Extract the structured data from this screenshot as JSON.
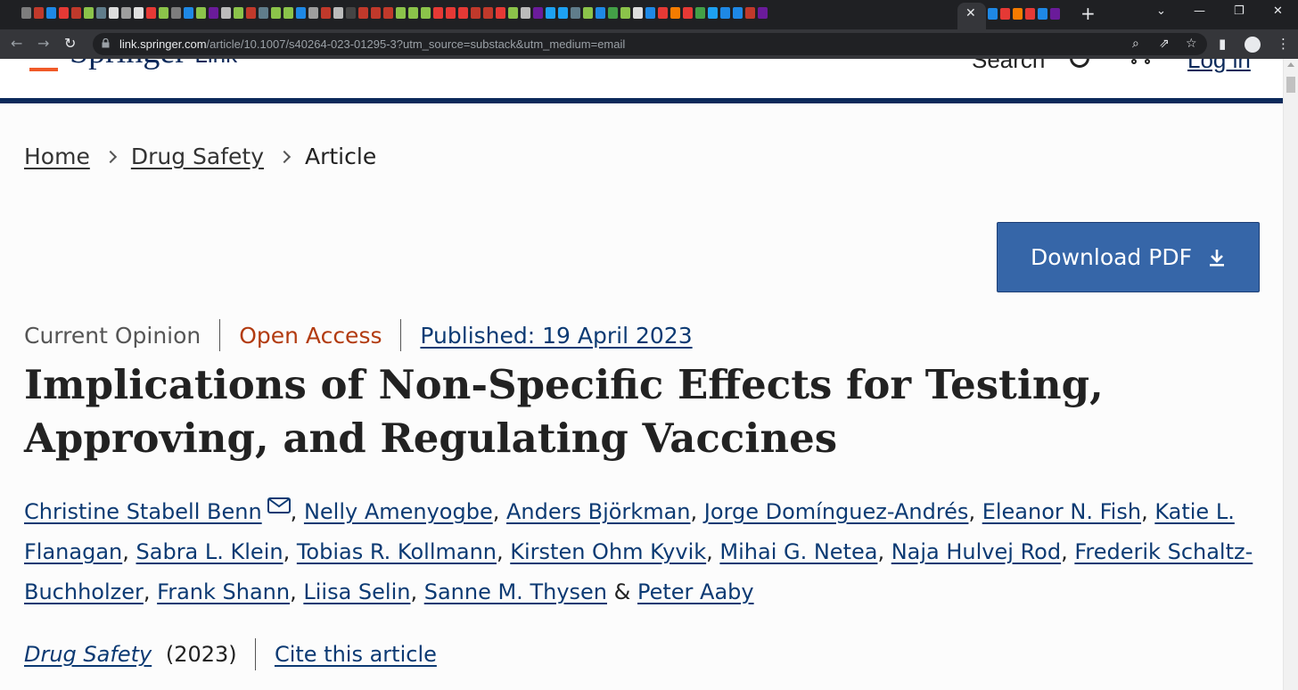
{
  "browser": {
    "active_tab_close": "✕",
    "new_tab": "+",
    "window_controls": [
      "⌄",
      "—",
      "❐",
      "✕"
    ],
    "url_host": "link.springer.com",
    "url_path": "/article/10.1007/s40264-023-01295-3?utm_source=substack&utm_medium=email",
    "nav": {
      "back": "←",
      "forward": "→",
      "reload": "↻"
    },
    "omnibox_icons": {
      "zoom": "⌕",
      "share": "⇗",
      "bookmark": "☆"
    },
    "toolbar_icons": {
      "sidepanel": "▮",
      "menu": "⋮"
    },
    "favicon_colors": [
      "#7d7d7d",
      "#c0392b",
      "#1e88e5",
      "#e53935",
      "#c0392b",
      "#8bc34a",
      "#607d8b",
      "#dddddd",
      "#9e9e9e",
      "#e0e0e0",
      "#e53935",
      "#8bc34a",
      "#7d7d7d",
      "#1e88e5",
      "#8bc34a",
      "#6a1b9a",
      "#bbbbbb",
      "#8bc34a",
      "#c0392b",
      "#607d8b",
      "#8bc34a",
      "#8bc34a",
      "#1e88e5",
      "#9e9e9e",
      "#c0392b",
      "#bbbbbb",
      "#444444",
      "#c0392b",
      "#c0392b",
      "#c0392b",
      "#8bc34a",
      "#8bc34a",
      "#8bc34a",
      "#e53935",
      "#e53935",
      "#e53935",
      "#c0392b",
      "#c0392b",
      "#e53935",
      "#8bc34a",
      "#bbbbbb",
      "#6a1b9a",
      "#1da1f2",
      "#1da1f2",
      "#607d8b",
      "#8bc34a",
      "#1e88e5",
      "#43a047",
      "#8bc34a",
      "#dddddd",
      "#1e88e5",
      "#e53935",
      "#f57c00",
      "#e53935",
      "#43a047",
      "#1da1f2",
      "#1e88e5",
      "#1e88e5",
      "#c0392b",
      "#6a1b9a"
    ],
    "right_favicon_colors": [
      "#1e88e5",
      "#e53935",
      "#f57c00",
      "#e53935",
      "#1e88e5",
      "#6a1b9a"
    ]
  },
  "site_header": {
    "logo_word": "Springer",
    "logo_sub": "Link",
    "search_label": "Search",
    "login_label": "Log in"
  },
  "breadcrumb": {
    "items": [
      "Home",
      "Drug Safety"
    ],
    "current": "Article"
  },
  "download": {
    "label": "Download PDF"
  },
  "meta": {
    "article_type": "Current Opinion",
    "access": "Open Access",
    "published": "Published: 19 April 2023"
  },
  "title": "Implications of Non-Specific Effects for Testing, Approving, and Regulating Vaccines",
  "authors": [
    "Christine Stabell Benn",
    "Nelly Amenyogbe",
    "Anders Björkman",
    "Jorge Domínguez-Andrés",
    "Eleanor N. Fish",
    "Katie L. Flanagan",
    "Sabra L. Klein",
    "Tobias R. Kollmann",
    "Kirsten Ohm Kyvik",
    "Mihai G. Netea",
    "Naja Hulvej Rod",
    "Frederik Schaltz-Buchholzer",
    "Frank Shann",
    "Liisa Selin",
    "Sanne M. Thysen",
    "Peter Aaby"
  ],
  "author_separator": ", ",
  "author_final_join": " & ",
  "journal": {
    "name": "Drug Safety",
    "year": "(2023)",
    "cite_label": "Cite this article"
  }
}
